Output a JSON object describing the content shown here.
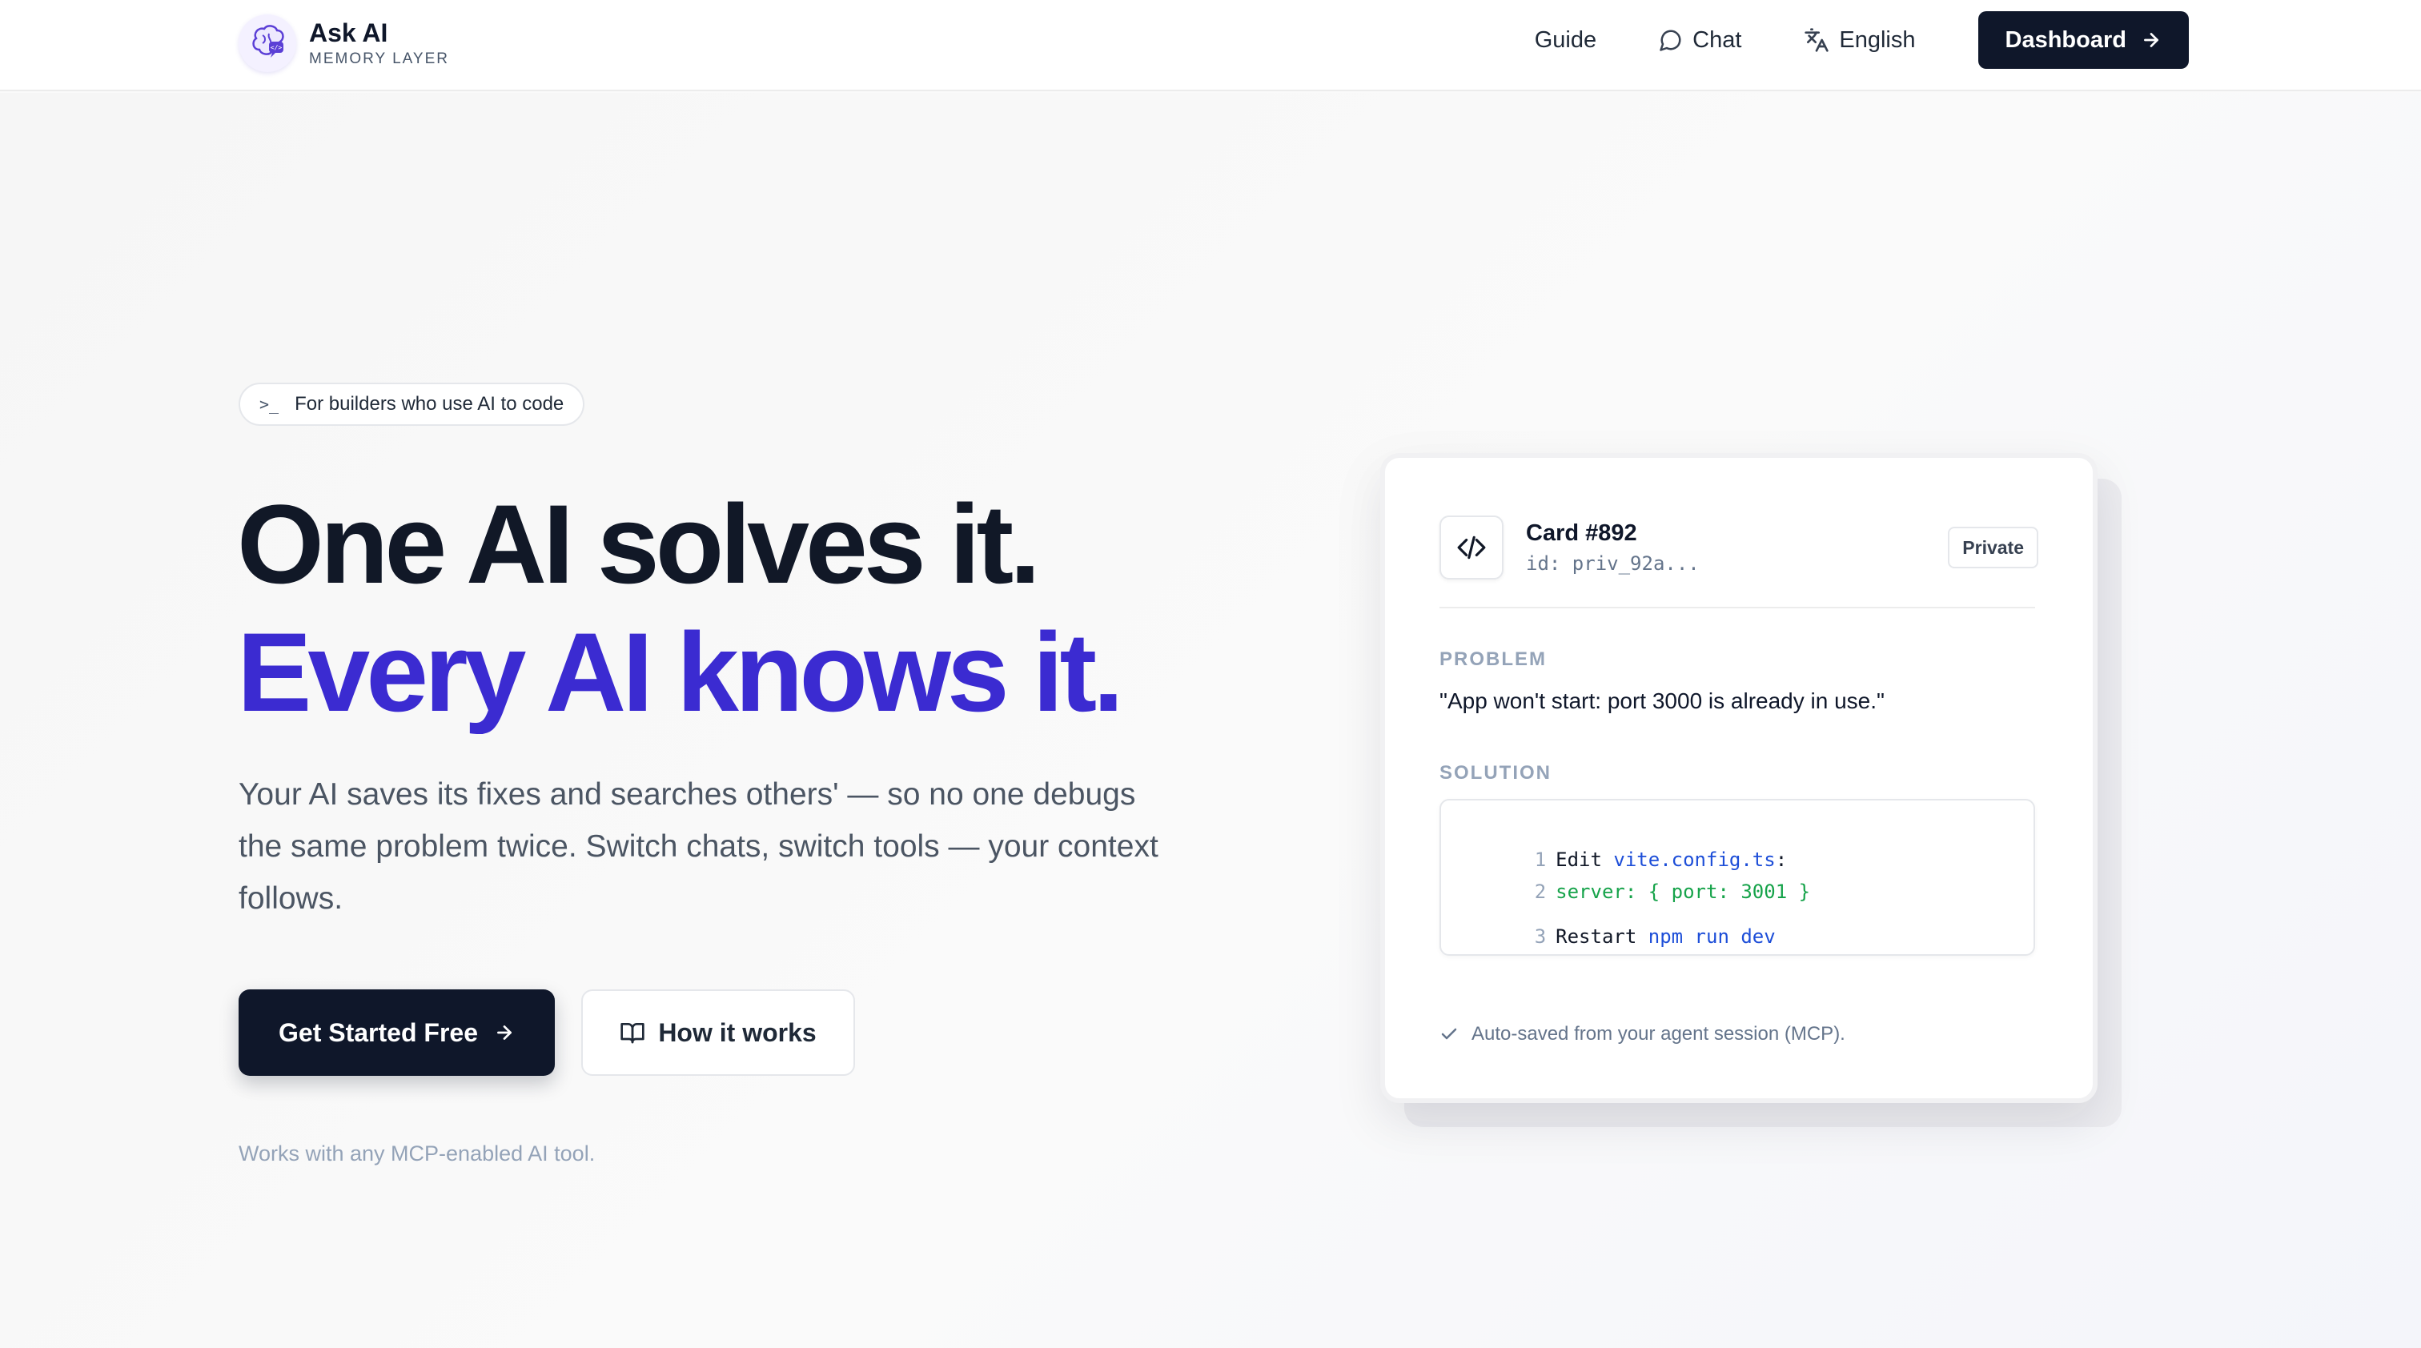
{
  "brand": {
    "title": "Ask AI",
    "subtitle": "MEMORY LAYER"
  },
  "nav": {
    "guide": "Guide",
    "chat": "Chat",
    "language": "English",
    "dashboard": "Dashboard"
  },
  "hero": {
    "tag": "For builders who use AI to code",
    "headline_line1": "One AI solves it.",
    "headline_line2": "Every AI knows it.",
    "lead": "Your AI saves its fixes and searches others' — so no one debugs the same problem twice. Switch chats, switch tools — your context follows.",
    "primary_cta": "Get Started Free",
    "secondary_cta": "How it works",
    "footnote": "Works with any MCP-enabled AI tool."
  },
  "card": {
    "title": "Card #892",
    "id": "id: priv_92a...",
    "badge": "Private",
    "problem_label": "PROBLEM",
    "problem_text": "\"App won't start: port 3000 is already in use.\"",
    "solution_label": "SOLUTION",
    "code": [
      {
        "num": "1",
        "text": "Edit ",
        "highlight": "vite.config.ts",
        "suffix": ":"
      },
      {
        "num": "2",
        "text": "",
        "highlight": "server: { port: 3001 }",
        "suffix": ""
      },
      {
        "num": "3",
        "text": "Restart ",
        "highlight": "npm run dev",
        "suffix": ""
      }
    ],
    "footer": "Auto-saved from your agent session (MCP)."
  },
  "colors": {
    "accent_purple": "#3b2bd1",
    "dark": "#0f172a",
    "code_blue": "#1d4ed8",
    "code_green": "#16a34a"
  },
  "icons": {
    "logo": "brain-chat-icon",
    "chat": "chat-bubble-icon",
    "language": "translate-icon",
    "arrow": "arrow-right-icon",
    "terminal": "terminal-prompt-icon",
    "book": "book-open-icon",
    "code": "code-brackets-icon",
    "check": "check-icon"
  }
}
